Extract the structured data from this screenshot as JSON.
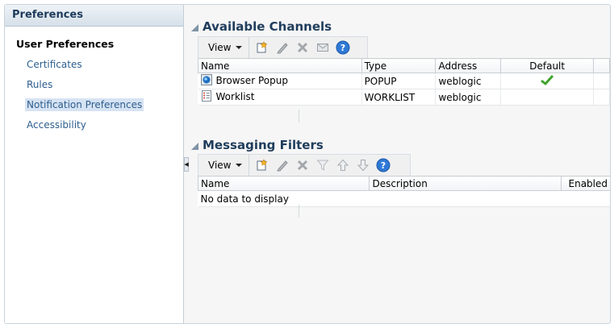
{
  "left_panel": {
    "header": "Preferences",
    "section_title": "User Preferences",
    "items": [
      {
        "label": "Certificates",
        "selected": false
      },
      {
        "label": "Rules",
        "selected": false
      },
      {
        "label": "Notification Preferences",
        "selected": true
      },
      {
        "label": "Accessibility",
        "selected": false
      }
    ]
  },
  "channels": {
    "title": "Available Channels",
    "toolbar": {
      "view_label": "View",
      "icons": [
        "create-icon",
        "edit-icon",
        "delete-icon",
        "email-icon",
        "help-icon"
      ]
    },
    "columns": [
      "Name",
      "Type",
      "Address",
      "Default"
    ],
    "rows": [
      {
        "icon": "browser-popup-icon",
        "name": "Browser Popup",
        "type": "POPUP",
        "address": "weblogic",
        "default": true
      },
      {
        "icon": "worklist-icon",
        "name": "Worklist",
        "type": "WORKLIST",
        "address": "weblogic",
        "default": false
      }
    ]
  },
  "filters": {
    "title": "Messaging Filters",
    "toolbar": {
      "view_label": "View",
      "icons": [
        "create-icon",
        "edit-icon",
        "delete-icon",
        "filter-icon",
        "move-up-icon",
        "move-down-icon",
        "help-icon"
      ]
    },
    "columns": [
      "Name",
      "Description",
      "Enabled"
    ],
    "empty_text": "No data to display"
  },
  "colors": {
    "link": "#2d5d8e",
    "selection": "#d6e3f3",
    "section_title": "#1f3d5c"
  }
}
